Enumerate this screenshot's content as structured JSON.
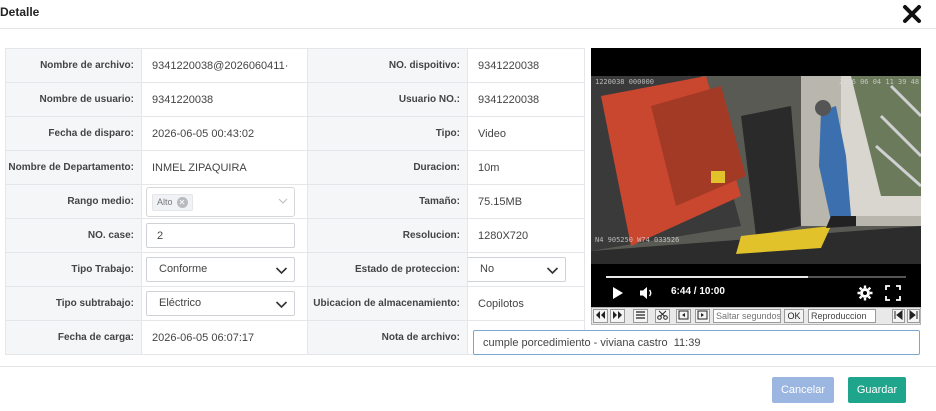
{
  "dialog": {
    "title": "Detalle"
  },
  "fields": {
    "nombre_archivo": {
      "label": "Nombre de archivo:",
      "value": "9341220038@2026060411·"
    },
    "no_dispositivo": {
      "label": "NO. dispoitivo:",
      "value": "9341220038"
    },
    "nombre_usuario": {
      "label": "Nombre de usuario:",
      "value": "9341220038"
    },
    "usuario_no": {
      "label": "Usuario NO.:",
      "value": "9341220038"
    },
    "fecha_disparo": {
      "label": "Fecha de disparo:",
      "value": "2026-06-05 00:43:02"
    },
    "tipo": {
      "label": "Tipo:",
      "value": "Video"
    },
    "nombre_departamento": {
      "label": "Nombre de Departamento:",
      "value": "INMEL ZIPAQUIRA"
    },
    "duracion": {
      "label": "Duracion:",
      "value": "10m"
    },
    "rango_medio": {
      "label": "Rango medio:",
      "tag": "Alto"
    },
    "tamano": {
      "label": "Tamaño:",
      "value": "75.15MB"
    },
    "no_case": {
      "label": "NO. case:",
      "value": "2"
    },
    "resolucion": {
      "label": "Resolucion:",
      "value": "1280X720"
    },
    "tipo_trabajo": {
      "label": "Tipo Trabajo:",
      "value": "Conforme"
    },
    "estado_proteccion": {
      "label": "Estado de proteccion:",
      "value": "No"
    },
    "tipo_subtrabajo": {
      "label": "Tipo subtrabajo:",
      "value": "Eléctrico"
    },
    "ubicacion": {
      "label": "Ubicacion de almacenamiento:",
      "value": "Copilotos"
    },
    "fecha_carga": {
      "label": "Fecha de carga:",
      "value": "2026-06-05 06:07:17"
    },
    "nota_archivo": {
      "label": "Nota de archivo:",
      "value": "cumple porcedimiento - viviana castro  11:39"
    }
  },
  "video": {
    "osd_top_left": "1220038 000000",
    "osd_top_right": "2026 06 04 11 39 48",
    "osd_bottom_left": "N4 905250  W74 033526",
    "time": "6:44 / 10:00",
    "progress": 0.674
  },
  "toolbar": {
    "skip_placeholder": "Saltar segundos",
    "ok_label": "OK",
    "speed_value": "Reproduccion"
  },
  "buttons": {
    "cancel": "Cancelar",
    "save": "Guardar"
  },
  "colors": {
    "cancel": "#9bb6e0",
    "save": "#1fa58c",
    "label_bg": "#f5f6f8",
    "note_border": "#7aa7cf"
  }
}
